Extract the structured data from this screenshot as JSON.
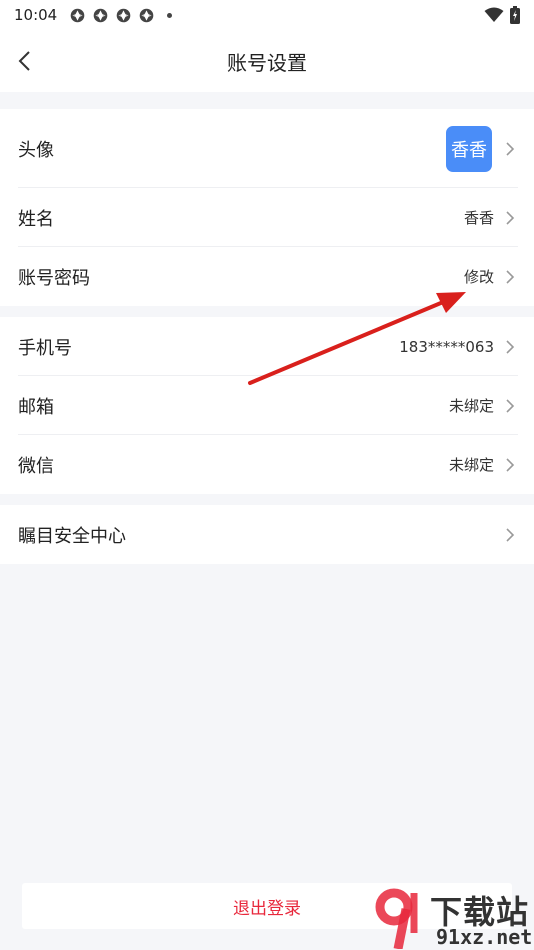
{
  "status_bar": {
    "time": "10:04",
    "icons": [
      "app-icon",
      "app-icon",
      "app-icon",
      "app-icon"
    ],
    "right_icons": [
      "wifi-icon",
      "battery-icon"
    ]
  },
  "header": {
    "title": "账号设置",
    "back_icon": "chevron-left-icon"
  },
  "group1": {
    "avatar": {
      "label": "头像",
      "avatar_text": "香香"
    },
    "name": {
      "label": "姓名",
      "value": "香香"
    },
    "account_password": {
      "label": "账号密码",
      "value": "修改"
    }
  },
  "group2": {
    "phone": {
      "label": "手机号",
      "value": "183*****063"
    },
    "email": {
      "label": "邮箱",
      "value": "未绑定"
    },
    "wechat": {
      "label": "微信",
      "value": "未绑定"
    }
  },
  "group3": {
    "security": {
      "label": "瞩目安全中心"
    }
  },
  "footer": {
    "logout_label": "退出登录"
  },
  "watermark": {
    "text_main": "下载站",
    "text_url": "91xz.net"
  },
  "colors": {
    "accent": "#4a8df8",
    "danger": "#e8283c",
    "background": "#f5f6f9",
    "annotation_arrow": "#d9201c"
  }
}
